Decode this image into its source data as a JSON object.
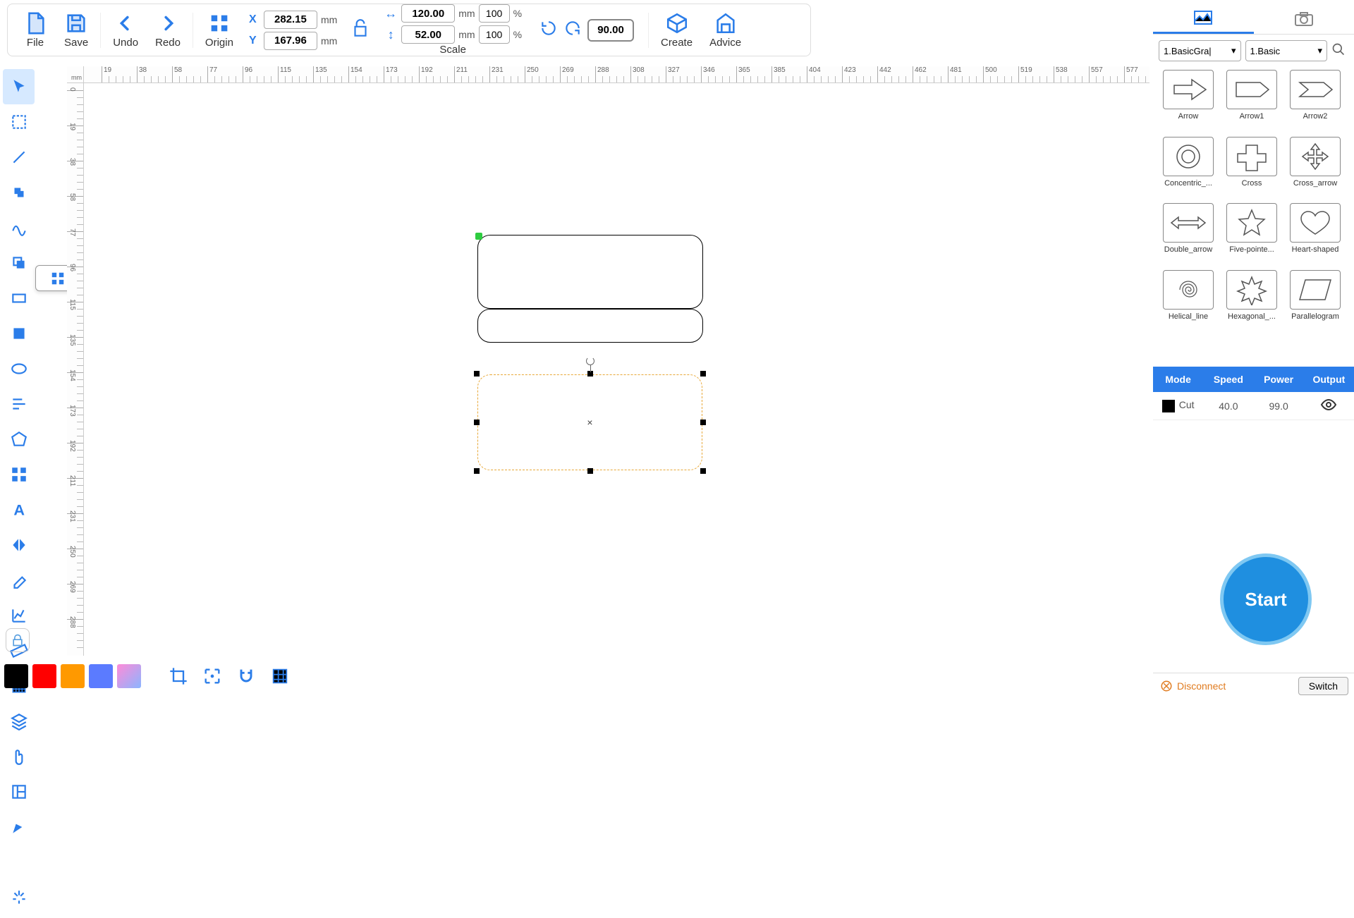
{
  "toolbar": {
    "file": "File",
    "save": "Save",
    "undo": "Undo",
    "redo": "Redo",
    "origin": "Origin",
    "scale": "Scale",
    "create": "Create",
    "advice": "Advice",
    "x_label": "X",
    "y_label": "Y",
    "x_value": "282.15",
    "y_value": "167.96",
    "mm": "mm",
    "pct": "%",
    "w_value": "120.00",
    "h_value": "52.00",
    "w_pct": "100",
    "h_pct": "100",
    "rotation": "90.00"
  },
  "tooltip": {
    "label": "Array"
  },
  "ruler": {
    "corner": "mm",
    "h_ticks": [
      "19",
      "38",
      "58",
      "77",
      "96",
      "115",
      "135",
      "154",
      "173",
      "192",
      "211",
      "231",
      "250",
      "269",
      "288",
      "308",
      "327",
      "346",
      "365",
      "385",
      "404",
      "423",
      "442",
      "462",
      "481",
      "500",
      "519",
      "538",
      "557",
      "577"
    ],
    "v_ticks": [
      "0",
      "19",
      "38",
      "58",
      "77",
      "96",
      "115",
      "135",
      "154",
      "173",
      "192",
      "211",
      "231",
      "250",
      "269",
      "288"
    ]
  },
  "right": {
    "select1": "1.BasicGra|",
    "select2": "1.Basic",
    "shapes": [
      "Arrow",
      "Arrow1",
      "Arrow2",
      "Concentric_...",
      "Cross",
      "Cross_arrow",
      "Double_arrow",
      "Five-pointe...",
      "Heart-shaped",
      "Helical_line",
      "Hexagonal_...",
      "Parallelogram"
    ],
    "params_header": [
      "Mode",
      "Speed",
      "Power",
      "Output"
    ],
    "params_row": {
      "mode": "Cut",
      "speed": "40.0",
      "power": "99.0"
    },
    "start": "Start",
    "disconnect": "Disconnect",
    "switch": "Switch"
  },
  "colors": [
    "#000000",
    "#ff0000",
    "#ff9900",
    "#5b7bff",
    "#e08bd8"
  ]
}
